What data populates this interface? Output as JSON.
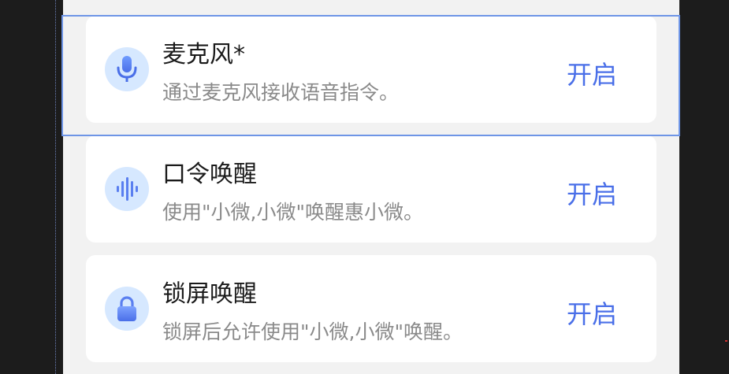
{
  "colors": {
    "accent": "#4a6fe8",
    "icon_bg": "#d6e8ff",
    "selection": "#6e95e6"
  },
  "permissions": [
    {
      "icon": "microphone-icon",
      "title": "麦克风*",
      "description": "通过麦克风接收语音指令。",
      "action": "开启"
    },
    {
      "icon": "voice-wave-icon",
      "title": "口令唤醒",
      "description": "使用\"小微,小微\"唤醒惠小微。",
      "action": "开启"
    },
    {
      "icon": "lock-icon",
      "title": "锁屏唤醒",
      "description": "锁屏后允许使用\"小微,小微\"唤醒。",
      "action": "开启"
    }
  ]
}
